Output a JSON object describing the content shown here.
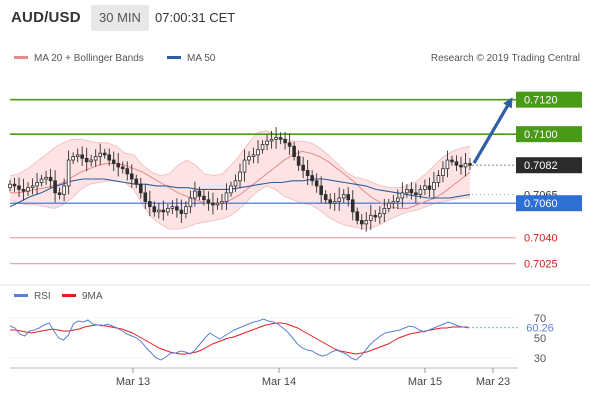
{
  "header": {
    "pair": "AUD/USD",
    "timeframe": "30 MIN",
    "time": "07:00:31 CET"
  },
  "colors": {
    "ma20": "#e88a8a",
    "ma50": "#2e5fa1",
    "band_fill": "#fde3e3",
    "resistance": "#4a9a1a",
    "support": "#2e6fd6",
    "support_weak": "#f2a6a6",
    "current": "#2b2b2b",
    "arrow": "#2e5fa1",
    "rsi": "#5a7fd6",
    "ma9": "#e02020",
    "candle": "#2e2e2e"
  },
  "chart_data": [
    {
      "type": "candlestick",
      "legend": [
        {
          "name": "MA 20 + Bollinger Bands",
          "color": "#e88a8a"
        },
        {
          "name": "MA 50",
          "color": "#2e5fa1"
        }
      ],
      "source": "Research © 2019 Trading Central",
      "ylim": [
        0.70155,
        0.71395
      ],
      "x_ticks": [
        "Mar 13",
        "Mar 14",
        "Mar 15",
        "Mar 23"
      ],
      "levels": [
        {
          "label": "0.7120",
          "value": 0.712,
          "kind": "resistance"
        },
        {
          "label": "0.7100",
          "value": 0.71,
          "kind": "resistance"
        },
        {
          "label": "0.7082",
          "value": 0.7082,
          "kind": "current"
        },
        {
          "label": "0.7065",
          "value": 0.7065,
          "kind": "pivot"
        },
        {
          "label": "0.7060",
          "value": 0.706,
          "kind": "support"
        },
        {
          "label": "0.7040",
          "value": 0.704,
          "kind": "support-minor"
        },
        {
          "label": "0.7025",
          "value": 0.7025,
          "kind": "support-minor"
        }
      ],
      "target": 0.712,
      "closes": [
        0.7071,
        0.707,
        0.7068,
        0.7067,
        0.7069,
        0.707,
        0.7072,
        0.7074,
        0.7075,
        0.7073,
        0.7066,
        0.7065,
        0.707,
        0.7085,
        0.7087,
        0.7088,
        0.7086,
        0.7084,
        0.7085,
        0.7087,
        0.7089,
        0.7088,
        0.7085,
        0.7083,
        0.7081,
        0.708,
        0.7077,
        0.7074,
        0.7071,
        0.7066,
        0.7061,
        0.7058,
        0.7055,
        0.7056,
        0.7055,
        0.7057,
        0.7058,
        0.7056,
        0.7054,
        0.7058,
        0.7063,
        0.7067,
        0.7064,
        0.7062,
        0.706,
        0.7059,
        0.706,
        0.7061,
        0.7066,
        0.707,
        0.7073,
        0.7078,
        0.7085,
        0.7087,
        0.7088,
        0.7091,
        0.7094,
        0.7096,
        0.7097,
        0.7098,
        0.7097,
        0.7095,
        0.7093,
        0.7087,
        0.7082,
        0.7079,
        0.7076,
        0.7073,
        0.707,
        0.7065,
        0.7062,
        0.706,
        0.7061,
        0.7063,
        0.7065,
        0.7062,
        0.7055,
        0.705,
        0.7048,
        0.705,
        0.7053,
        0.7052,
        0.7054,
        0.7057,
        0.706,
        0.7061,
        0.7063,
        0.7066,
        0.7068,
        0.7066,
        0.7065,
        0.7068,
        0.707,
        0.7068,
        0.7072,
        0.7076,
        0.708,
        0.7085,
        0.7084,
        0.7082,
        0.7081,
        0.7083,
        0.7082
      ],
      "ma20": [
        0.7066,
        0.7066,
        0.7067,
        0.7068,
        0.7069,
        0.707,
        0.7072,
        0.7075,
        0.7078,
        0.708,
        0.7082,
        0.7083,
        0.7083,
        0.7082,
        0.708,
        0.7078,
        0.7075,
        0.7072,
        0.7069,
        0.7066,
        0.7064,
        0.7062,
        0.706,
        0.706,
        0.706,
        0.7062,
        0.7065,
        0.7069,
        0.7073,
        0.7077,
        0.7081,
        0.7085,
        0.7088,
        0.709,
        0.7089,
        0.7087,
        0.7084,
        0.708,
        0.7076,
        0.7072,
        0.7067,
        0.7063,
        0.706,
        0.7058,
        0.7057,
        0.7057,
        0.7059,
        0.7061,
        0.7063,
        0.7066,
        0.707,
        0.7074,
        0.7078
      ],
      "bb_upper": [
        0.7076,
        0.7077,
        0.708,
        0.7084,
        0.7088,
        0.7092,
        0.7095,
        0.7097,
        0.7097,
        0.7096,
        0.7095,
        0.7095,
        0.7093,
        0.7089,
        0.7088,
        0.7082,
        0.7078,
        0.7076,
        0.7077,
        0.7082,
        0.7085,
        0.7082,
        0.7077,
        0.7076,
        0.7077,
        0.7082,
        0.7088,
        0.7095,
        0.7101,
        0.7102,
        0.71,
        0.7097,
        0.7096,
        0.7096,
        0.7095,
        0.7092,
        0.7088,
        0.7083,
        0.7078,
        0.7075,
        0.7074,
        0.7072,
        0.707,
        0.7069,
        0.7069,
        0.707,
        0.7073,
        0.7077,
        0.7082,
        0.7087,
        0.709,
        0.7092,
        0.7093
      ],
      "bb_lower": [
        0.7062,
        0.706,
        0.7059,
        0.7059,
        0.7058,
        0.7057,
        0.7059,
        0.7063,
        0.7068,
        0.7071,
        0.7072,
        0.7073,
        0.7073,
        0.7072,
        0.7068,
        0.7059,
        0.7052,
        0.7048,
        0.7045,
        0.7045,
        0.7046,
        0.7048,
        0.7049,
        0.705,
        0.7051,
        0.7053,
        0.7057,
        0.7062,
        0.7067,
        0.707,
        0.7068,
        0.7064,
        0.7062,
        0.706,
        0.7059,
        0.7056,
        0.7052,
        0.7049,
        0.7047,
        0.7046,
        0.7045,
        0.7046,
        0.7048,
        0.7051,
        0.7053,
        0.7055,
        0.7056,
        0.7058,
        0.706,
        0.7061,
        0.7062,
        0.7063,
        0.7063
      ],
      "ma50": [
        0.7058,
        0.7061,
        0.7064,
        0.7066,
        0.7069,
        0.7071,
        0.7073,
        0.7074,
        0.7074,
        0.7074,
        0.7073,
        0.7072,
        0.7071,
        0.7071,
        0.707,
        0.707,
        0.7069,
        0.7069,
        0.7068,
        0.7068,
        0.7068,
        0.7068,
        0.7069,
        0.707,
        0.7071,
        0.7072,
        0.7072,
        0.7073,
        0.7073,
        0.7074,
        0.7074,
        0.7073,
        0.7072,
        0.7071,
        0.707,
        0.7068,
        0.7067,
        0.7066,
        0.7065,
        0.7064,
        0.7063,
        0.7063,
        0.7063,
        0.7064,
        0.7065
      ]
    },
    {
      "type": "line",
      "legend": [
        {
          "name": "RSI",
          "color": "#5a7fd6"
        },
        {
          "name": "9MA",
          "color": "#e02020"
        }
      ],
      "ylim": [
        20,
        80
      ],
      "y_ticks": [
        70,
        50,
        30
      ],
      "current_label": "60.26",
      "current_value": 60.26,
      "rsi": [
        62,
        60,
        54,
        52,
        57,
        58,
        60,
        63,
        65,
        57,
        50,
        48,
        53,
        64,
        67,
        66,
        68,
        64,
        63,
        62,
        64,
        62,
        60,
        57,
        54,
        52,
        50,
        46,
        40,
        35,
        30,
        28,
        31,
        35,
        35,
        37,
        36,
        34,
        38,
        44,
        50,
        55,
        52,
        49,
        52,
        55,
        58,
        60,
        62,
        64,
        66,
        67,
        69,
        67,
        66,
        64,
        60,
        56,
        50,
        44,
        40,
        38,
        37,
        34,
        32,
        33,
        36,
        38,
        36,
        34,
        30,
        28,
        32,
        38,
        44,
        48,
        52,
        55,
        56,
        57,
        58,
        60,
        62,
        61,
        58,
        56,
        58,
        60,
        62,
        64,
        66,
        64,
        62,
        61,
        60
      ],
      "ma9": [
        58,
        58,
        57,
        56,
        55,
        56,
        57,
        58,
        59,
        58,
        57,
        57,
        58,
        59,
        61,
        62,
        63,
        63,
        62,
        61,
        60,
        59,
        57,
        55,
        52,
        49,
        46,
        43,
        40,
        38,
        36,
        35,
        34,
        34,
        35,
        36,
        38,
        41,
        44,
        46,
        48,
        50,
        51,
        53,
        55,
        57,
        59,
        61,
        63,
        64,
        65,
        65,
        64,
        62,
        60,
        57,
        54,
        51,
        48,
        45,
        42,
        39,
        37,
        36,
        35,
        34,
        35,
        36,
        38,
        40,
        42,
        44,
        47,
        50,
        52,
        54,
        55,
        56,
        57,
        58,
        59,
        60,
        60,
        61,
        61,
        61,
        61
      ]
    }
  ]
}
